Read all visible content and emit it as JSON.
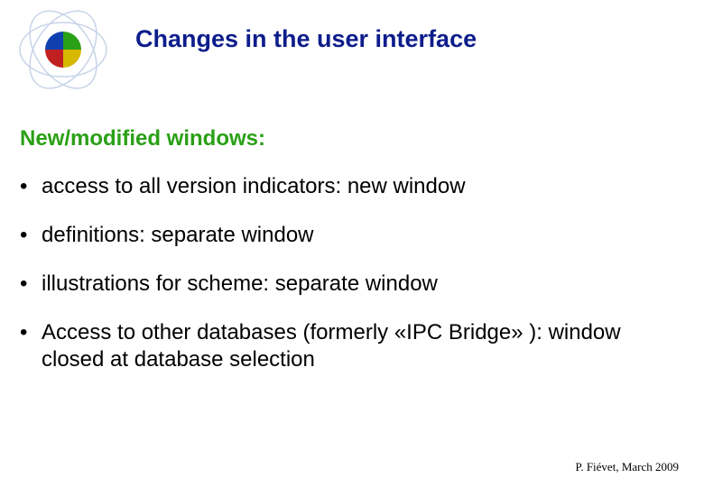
{
  "header": {
    "title": "Changes in the user interface"
  },
  "section": {
    "heading": "New/modified windows:"
  },
  "bullets": {
    "item1": "access to all version indicators: new window",
    "item2": "definitions: separate window",
    "item3": "illustrations for scheme: separate window",
    "item4": "Access to other databases (formerly «IPC Bridge» ): window closed at database selection"
  },
  "footer": {
    "text": "P. Fiévet, March 2009"
  }
}
